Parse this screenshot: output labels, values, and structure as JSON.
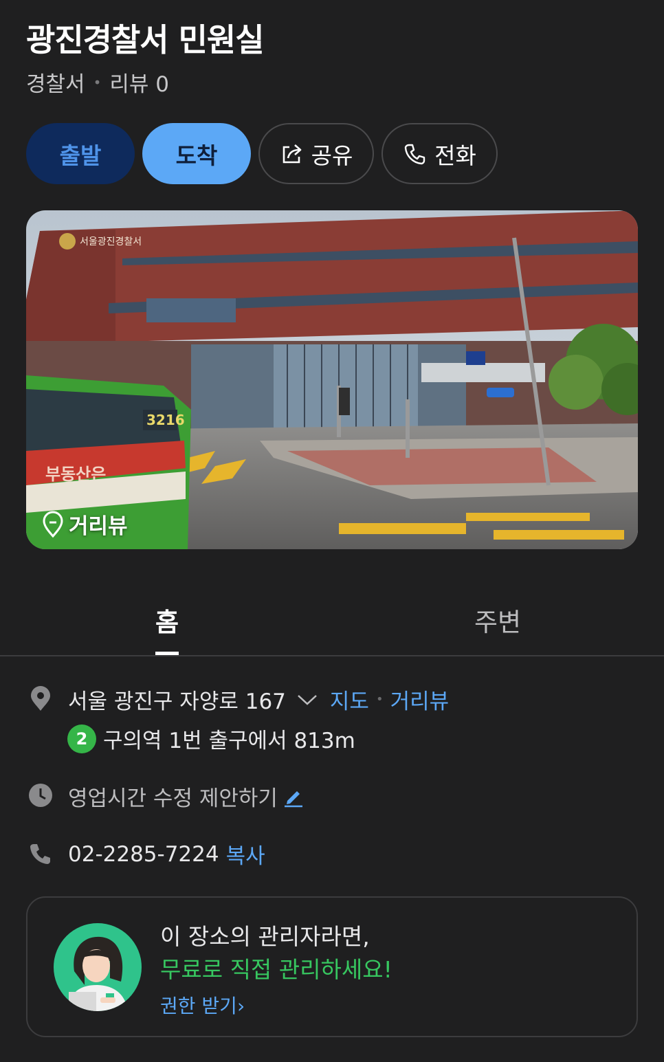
{
  "place": {
    "name": "광진경찰서 민원실",
    "category": "경찰서",
    "review_label": "리뷰 0"
  },
  "actions": {
    "depart": "출발",
    "arrive": "도착",
    "share": "공유",
    "call": "전화"
  },
  "photo": {
    "streetview_label": "거리뷰",
    "sign_text": "서울광진경찰서",
    "bus_number": "3216",
    "bus_ad_text": "부동산은"
  },
  "tabs": [
    {
      "label": "홈",
      "active": true
    },
    {
      "label": "주변",
      "active": false
    }
  ],
  "details": {
    "address": "서울 광진구 자양로 167",
    "map_link": "지도",
    "streetview_link": "거리뷰",
    "subway_line": "2",
    "subway_line_color": "#35b548",
    "subway_text": "구의역 1번 출구에서 813m",
    "hours_text": "영업시간 수정 제안하기",
    "phone": "02-2285-7224",
    "copy_link": "복사"
  },
  "owner_card": {
    "line1": "이 장소의 관리자라면,",
    "line2": "무료로 직접 관리하세요!",
    "link": "권한 받기",
    "link_chevron": "›"
  },
  "colors": {
    "background": "#1f1f20",
    "accent_blue": "#5ca8f6",
    "depart_bg": "#0e2a5c",
    "green": "#37c760"
  }
}
